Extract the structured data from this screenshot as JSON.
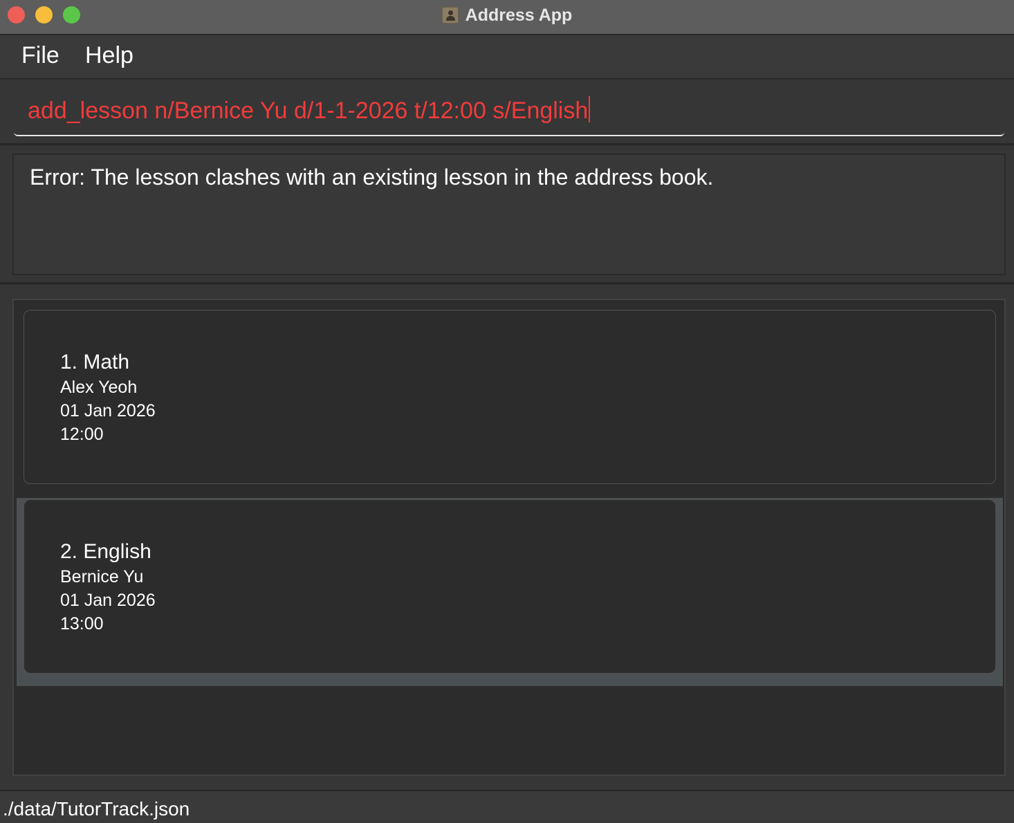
{
  "window": {
    "title": "Address App",
    "icon": "address-book-icon"
  },
  "menu": {
    "items": [
      "File",
      "Help"
    ]
  },
  "command": {
    "value": "add_lesson n/Bernice Yu d/1-1-2026 t/12:00 s/English",
    "text_color": "#f23b3b"
  },
  "result": {
    "message": "Error: The lesson clashes with an existing lesson in the address book."
  },
  "lessons": [
    {
      "title": "1. Math",
      "student": "Alex Yeoh",
      "date": "01 Jan 2026",
      "time": "12:00"
    },
    {
      "title": "2. English",
      "student": "Bernice Yu",
      "date": "01 Jan 2026",
      "time": "13:00"
    }
  ],
  "status": {
    "file_path": "./data/TutorTrack.json"
  }
}
